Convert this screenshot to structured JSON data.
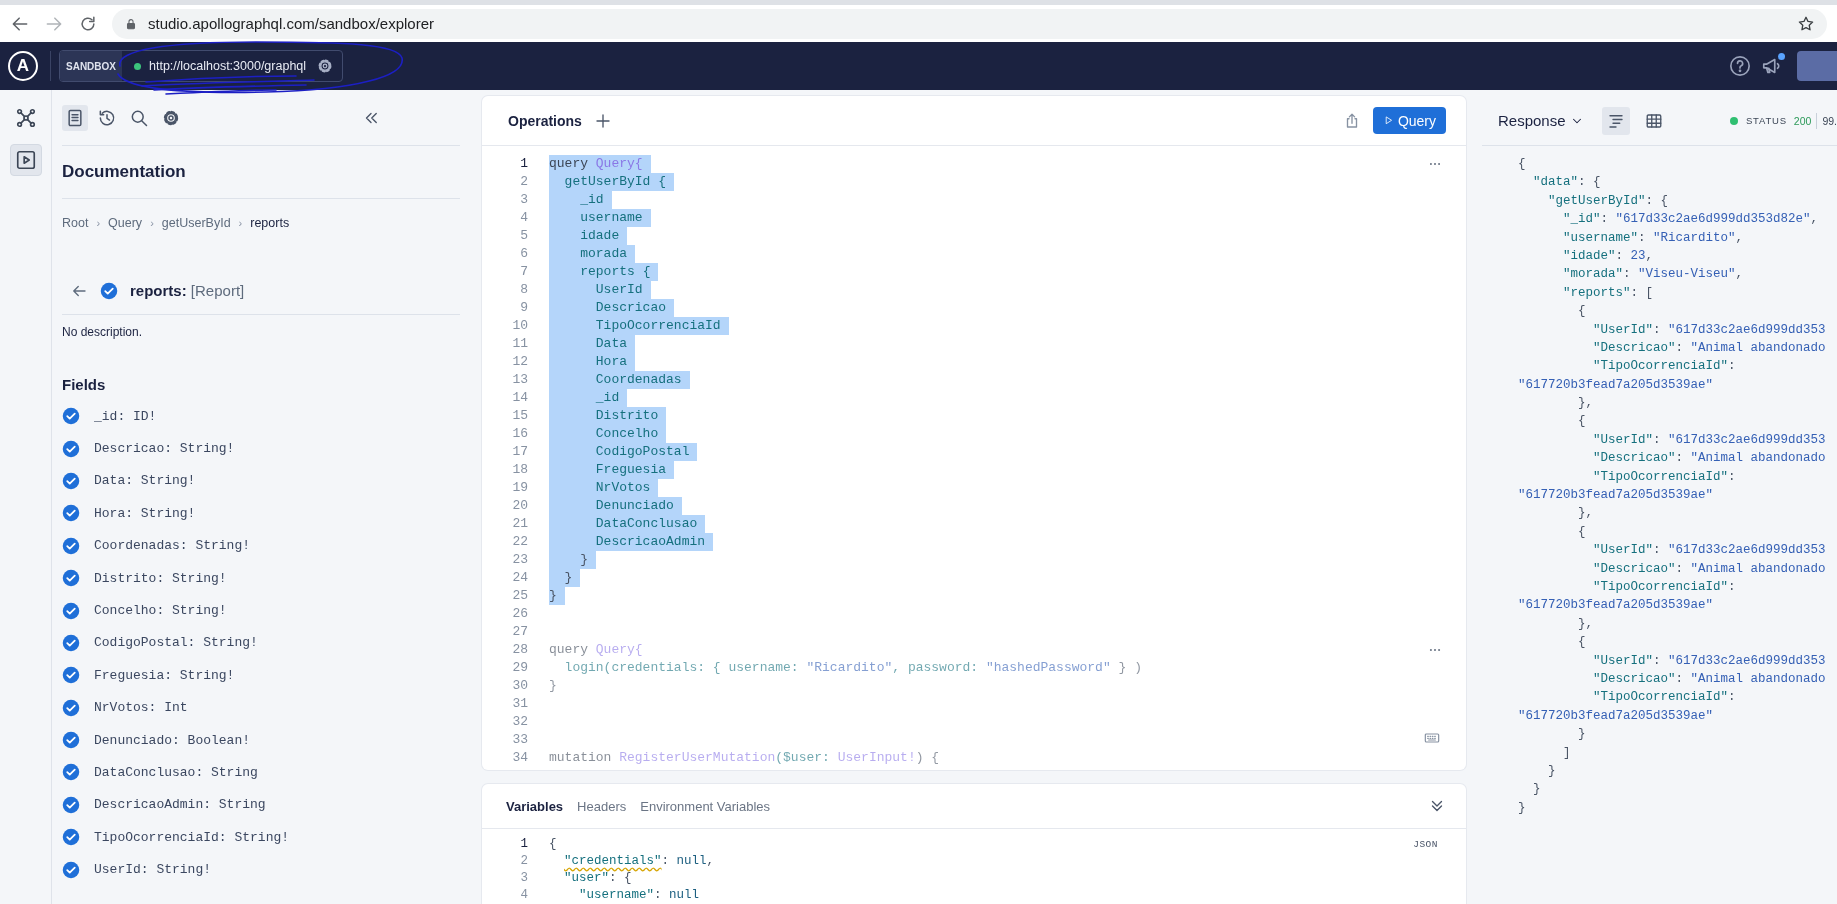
{
  "browser": {
    "url": "studio.apollographql.com/sandbox/explorer"
  },
  "header": {
    "logo": "A",
    "sandbox_label": "SANDBOX",
    "endpoint": "http://localhost:3000/graphql",
    "connected": true,
    "notification": true
  },
  "rail": [
    {
      "kind": "schema",
      "selected": false
    },
    {
      "kind": "explorer",
      "selected": true
    }
  ],
  "docs": {
    "tools": [
      {
        "kind": "documentation",
        "selected": true
      },
      {
        "kind": "history",
        "selected": false
      },
      {
        "kind": "search",
        "selected": false
      },
      {
        "kind": "settings",
        "selected": false
      }
    ],
    "title": "Documentation",
    "breadcrumb_separator": "›",
    "breadcrumb": [
      {
        "label": "Root",
        "selected": false
      },
      {
        "label": "Query",
        "selected": false
      },
      {
        "label": "getUserById",
        "selected": false
      },
      {
        "label": "reports",
        "selected": true
      }
    ],
    "current": "**reports:** [Report]",
    "current_checked": true,
    "description": "No description.",
    "fields_heading": "Fields",
    "fields": [
      {
        "text": "_id: ID!",
        "checked": true
      },
      {
        "text": "Descricao: String!",
        "checked": true
      },
      {
        "text": "Data: String!",
        "checked": true
      },
      {
        "text": "Hora: String!",
        "checked": true
      },
      {
        "text": "Coordenadas: String!",
        "checked": true
      },
      {
        "text": "Distrito: String!",
        "checked": true
      },
      {
        "text": "Concelho: String!",
        "checked": true
      },
      {
        "text": "CodigoPostal: String!",
        "checked": true
      },
      {
        "text": "Freguesia: String!",
        "checked": true
      },
      {
        "text": "NrVotos: Int",
        "checked": true
      },
      {
        "text": "Denunciado: Boolean!",
        "checked": true
      },
      {
        "text": "DataConclusao: String",
        "checked": true
      },
      {
        "text": "DescricaoAdmin: String",
        "checked": true
      },
      {
        "text": "TipoOcorrenciaId: String!",
        "checked": true
      },
      {
        "text": "UserId: String!",
        "checked": true
      }
    ]
  },
  "editor": {
    "title": "Operations",
    "run_button": "Query",
    "lines": [
      {
        "number": "1",
        "selected": true,
        "dimmed": false,
        "menu": true,
        "segments": [
          {
            "text": "query ",
            "kind": "keyword"
          },
          {
            "text": "Query{",
            "kind": "type"
          }
        ]
      },
      {
        "number": "2",
        "selected": true,
        "dimmed": false,
        "segments": [
          {
            "text": "  getUserById {",
            "kind": "field"
          }
        ]
      },
      {
        "number": "3",
        "selected": true,
        "dimmed": false,
        "segments": [
          {
            "text": "    _id",
            "kind": "field"
          }
        ]
      },
      {
        "number": "4",
        "selected": true,
        "dimmed": false,
        "segments": [
          {
            "text": "    username",
            "kind": "field"
          }
        ]
      },
      {
        "number": "5",
        "selected": true,
        "dimmed": false,
        "segments": [
          {
            "text": "    idade",
            "kind": "field"
          }
        ]
      },
      {
        "number": "6",
        "selected": true,
        "dimmed": false,
        "segments": [
          {
            "text": "    morada",
            "kind": "field"
          }
        ]
      },
      {
        "number": "7",
        "selected": true,
        "dimmed": false,
        "segments": [
          {
            "text": "    reports {",
            "kind": "field"
          }
        ]
      },
      {
        "number": "8",
        "selected": true,
        "dimmed": false,
        "segments": [
          {
            "text": "      UserId",
            "kind": "field"
          }
        ]
      },
      {
        "number": "9",
        "selected": true,
        "dimmed": false,
        "segments": [
          {
            "text": "      Descricao",
            "kind": "field"
          }
        ]
      },
      {
        "number": "10",
        "selected": true,
        "dimmed": false,
        "segments": [
          {
            "text": "      TipoOcorrenciaId",
            "kind": "field"
          }
        ]
      },
      {
        "number": "11",
        "selected": true,
        "dimmed": false,
        "segments": [
          {
            "text": "      Data",
            "kind": "field"
          }
        ]
      },
      {
        "number": "12",
        "selected": true,
        "dimmed": false,
        "segments": [
          {
            "text": "      Hora",
            "kind": "field"
          }
        ]
      },
      {
        "number": "13",
        "selected": true,
        "dimmed": false,
        "segments": [
          {
            "text": "      Coordenadas",
            "kind": "field"
          }
        ]
      },
      {
        "number": "14",
        "selected": true,
        "dimmed": false,
        "segments": [
          {
            "text": "      _id",
            "kind": "field"
          }
        ]
      },
      {
        "number": "15",
        "selected": true,
        "dimmed": false,
        "segments": [
          {
            "text": "      Distrito",
            "kind": "field"
          }
        ]
      },
      {
        "number": "16",
        "selected": true,
        "dimmed": false,
        "segments": [
          {
            "text": "      Concelho",
            "kind": "field"
          }
        ]
      },
      {
        "number": "17",
        "selected": true,
        "dimmed": false,
        "segments": [
          {
            "text": "      CodigoPostal",
            "kind": "field"
          }
        ]
      },
      {
        "number": "18",
        "selected": true,
        "dimmed": false,
        "segments": [
          {
            "text": "      Freguesia",
            "kind": "field"
          }
        ]
      },
      {
        "number": "19",
        "selected": true,
        "dimmed": false,
        "segments": [
          {
            "text": "      NrVotos",
            "kind": "field"
          }
        ]
      },
      {
        "number": "20",
        "selected": true,
        "dimmed": false,
        "segments": [
          {
            "text": "      Denunciado",
            "kind": "field"
          }
        ]
      },
      {
        "number": "21",
        "selected": true,
        "dimmed": false,
        "segments": [
          {
            "text": "      DataConclusao",
            "kind": "field"
          }
        ]
      },
      {
        "number": "22",
        "selected": true,
        "dimmed": false,
        "segments": [
          {
            "text": "      DescricaoAdmin",
            "kind": "field"
          }
        ]
      },
      {
        "number": "23",
        "selected": true,
        "dimmed": false,
        "segments": [
          {
            "text": "    }",
            "kind": "punct"
          }
        ]
      },
      {
        "number": "24",
        "selected": true,
        "dimmed": false,
        "segments": [
          {
            "text": "  }",
            "kind": "punct"
          }
        ]
      },
      {
        "number": "25",
        "selected": true,
        "dimmed": false,
        "segments": [
          {
            "text": "}",
            "kind": "punct"
          }
        ]
      },
      {
        "number": "26"
      },
      {
        "number": "27"
      },
      {
        "number": "28",
        "selected": false,
        "dimmed": true,
        "menu": true,
        "segments": [
          {
            "text": "query ",
            "kind": "keyword"
          },
          {
            "text": "Query{",
            "kind": "type"
          }
        ]
      },
      {
        "number": "29",
        "selected": false,
        "dimmed": true,
        "segments": [
          {
            "text": "  login(credentials: { username: ",
            "kind": "field"
          },
          {
            "text": "\"Ricardito\"",
            "kind": "string"
          },
          {
            "text": ", password: ",
            "kind": "field"
          },
          {
            "text": "\"hashedPassword\"",
            "kind": "string"
          },
          {
            "text": " } )",
            "kind": "punct"
          }
        ]
      },
      {
        "number": "30",
        "selected": false,
        "dimmed": true,
        "segments": [
          {
            "text": "}",
            "kind": "punct"
          }
        ]
      },
      {
        "number": "31"
      },
      {
        "number": "32"
      },
      {
        "number": "33"
      },
      {
        "number": "34",
        "selected": false,
        "dimmed": true,
        "segments": [
          {
            "text": "mutation ",
            "kind": "keyword"
          },
          {
            "text": "RegisterUserMutation",
            "kind": "type"
          },
          {
            "text": "($user: ",
            "kind": "field"
          },
          {
            "text": "UserInput!",
            "kind": "type"
          },
          {
            "text": ") {",
            "kind": "punct"
          }
        ]
      }
    ]
  },
  "variables": {
    "tabs": [
      {
        "label": "Variables",
        "selected": true
      },
      {
        "label": "Headers",
        "selected": false
      },
      {
        "label": "Environment Variables",
        "selected": false
      }
    ],
    "format": "JSON",
    "lines": [
      {
        "number": "1",
        "segments": [
          {
            "text": "{",
            "kind": "punct"
          }
        ]
      },
      {
        "number": "2",
        "segments": [
          {
            "text": "  \"credentials\"",
            "kind": "key_warning"
          },
          {
            "text": ": ",
            "kind": "punct"
          },
          {
            "text": "null",
            "kind": "null"
          },
          {
            "text": ",",
            "kind": "punct"
          }
        ]
      },
      {
        "number": "3",
        "segments": [
          {
            "text": "  \"user\"",
            "kind": "key"
          },
          {
            "text": ": {",
            "kind": "punct"
          }
        ]
      },
      {
        "number": "4",
        "segments": [
          {
            "text": "    \"username\"",
            "kind": "key"
          },
          {
            "text": ": ",
            "kind": "punct"
          },
          {
            "text": "null",
            "kind": "null"
          }
        ]
      }
    ]
  },
  "response": {
    "title": "Response",
    "views": [
      {
        "kind": "tree",
        "selected": true
      },
      {
        "kind": "table",
        "selected": false
      }
    ],
    "status_ok": true,
    "status_label": "STATUS",
    "status_code": "200",
    "time": "99.",
    "lines": [
      [
        {
          "text": "{",
          "kind": "punct"
        }
      ],
      [
        {
          "text": "  \"data\"",
          "kind": "key"
        },
        {
          "text": ": {",
          "kind": "punct"
        }
      ],
      [
        {
          "text": "    \"getUserById\"",
          "kind": "key"
        },
        {
          "text": ": {",
          "kind": "punct"
        }
      ],
      [
        {
          "text": "      \"_id\"",
          "kind": "key"
        },
        {
          "text": ": ",
          "kind": "punct"
        },
        {
          "text": "\"617d33c2ae6d999dd353d82e\"",
          "kind": "string"
        },
        {
          "text": ",",
          "kind": "punct"
        }
      ],
      [
        {
          "text": "      \"username\"",
          "kind": "key"
        },
        {
          "text": ": ",
          "kind": "punct"
        },
        {
          "text": "\"Ricardito\"",
          "kind": "string"
        },
        {
          "text": ",",
          "kind": "punct"
        }
      ],
      [
        {
          "text": "      \"idade\"",
          "kind": "key"
        },
        {
          "text": ": ",
          "kind": "punct"
        },
        {
          "text": "23",
          "kind": "number"
        },
        {
          "text": ",",
          "kind": "punct"
        }
      ],
      [
        {
          "text": "      \"morada\"",
          "kind": "key"
        },
        {
          "text": ": ",
          "kind": "punct"
        },
        {
          "text": "\"Viseu-Viseu\"",
          "kind": "string"
        },
        {
          "text": ",",
          "kind": "punct"
        }
      ],
      [
        {
          "text": "      \"reports\"",
          "kind": "key"
        },
        {
          "text": ": [",
          "kind": "punct"
        }
      ],
      [
        {
          "text": "        {",
          "kind": "punct"
        }
      ],
      [
        {
          "text": "          \"UserId\"",
          "kind": "key"
        },
        {
          "text": ": ",
          "kind": "punct"
        },
        {
          "text": "\"617d33c2ae6d999dd353",
          "kind": "string"
        }
      ],
      [
        {
          "text": "          \"Descricao\"",
          "kind": "key"
        },
        {
          "text": ": ",
          "kind": "punct"
        },
        {
          "text": "\"Animal abandonado",
          "kind": "string"
        }
      ],
      [
        {
          "text": "          \"TipoOcorrenciaId\"",
          "kind": "key"
        },
        {
          "text": ":",
          "kind": "punct"
        }
      ],
      [
        {
          "text": "\"617720b3fead7a205d3539ae\"",
          "kind": "string"
        }
      ],
      [
        {
          "text": "        },",
          "kind": "punct"
        }
      ],
      [
        {
          "text": "        {",
          "kind": "punct"
        }
      ],
      [
        {
          "text": "          \"UserId\"",
          "kind": "key"
        },
        {
          "text": ": ",
          "kind": "punct"
        },
        {
          "text": "\"617d33c2ae6d999dd353",
          "kind": "string"
        }
      ],
      [
        {
          "text": "          \"Descricao\"",
          "kind": "key"
        },
        {
          "text": ": ",
          "kind": "punct"
        },
        {
          "text": "\"Animal abandonado",
          "kind": "string"
        }
      ],
      [
        {
          "text": "          \"TipoOcorrenciaId\"",
          "kind": "key"
        },
        {
          "text": ":",
          "kind": "punct"
        }
      ],
      [
        {
          "text": "\"617720b3fead7a205d3539ae\"",
          "kind": "string"
        }
      ],
      [
        {
          "text": "        },",
          "kind": "punct"
        }
      ],
      [
        {
          "text": "        {",
          "kind": "punct"
        }
      ],
      [
        {
          "text": "          \"UserId\"",
          "kind": "key"
        },
        {
          "text": ": ",
          "kind": "punct"
        },
        {
          "text": "\"617d33c2ae6d999dd353",
          "kind": "string"
        }
      ],
      [
        {
          "text": "          \"Descricao\"",
          "kind": "key"
        },
        {
          "text": ": ",
          "kind": "punct"
        },
        {
          "text": "\"Animal abandonado",
          "kind": "string"
        }
      ],
      [
        {
          "text": "          \"TipoOcorrenciaId\"",
          "kind": "key"
        },
        {
          "text": ":",
          "kind": "punct"
        }
      ],
      [
        {
          "text": "\"617720b3fead7a205d3539ae\"",
          "kind": "string"
        }
      ],
      [
        {
          "text": "        },",
          "kind": "punct"
        }
      ],
      [
        {
          "text": "        {",
          "kind": "punct"
        }
      ],
      [
        {
          "text": "          \"UserId\"",
          "kind": "key"
        },
        {
          "text": ": ",
          "kind": "punct"
        },
        {
          "text": "\"617d33c2ae6d999dd353",
          "kind": "string"
        }
      ],
      [
        {
          "text": "          \"Descricao\"",
          "kind": "key"
        },
        {
          "text": ": ",
          "kind": "punct"
        },
        {
          "text": "\"Animal abandonado",
          "kind": "string"
        }
      ],
      [
        {
          "text": "          \"TipoOcorrenciaId\"",
          "kind": "key"
        },
        {
          "text": ":",
          "kind": "punct"
        }
      ],
      [
        {
          "text": "\"617720b3fead7a205d3539ae\"",
          "kind": "string"
        }
      ],
      [
        {
          "text": "        }",
          "kind": "punct"
        }
      ],
      [
        {
          "text": "      ]",
          "kind": "punct"
        }
      ],
      [
        {
          "text": "    }",
          "kind": "punct"
        }
      ],
      [
        {
          "text": "  }",
          "kind": "punct"
        }
      ],
      [
        {
          "text": "}",
          "kind": "punct"
        }
      ]
    ]
  }
}
